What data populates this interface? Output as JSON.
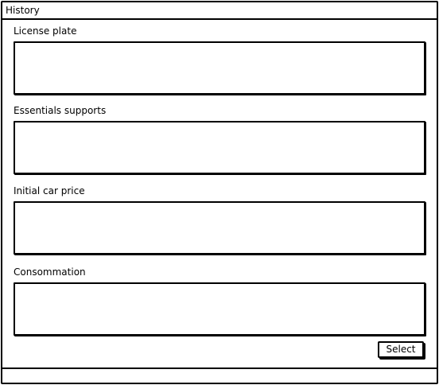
{
  "window": {
    "title": "History"
  },
  "fields": [
    {
      "label": "License plate",
      "value": ""
    },
    {
      "label": "Essentials supports",
      "value": ""
    },
    {
      "label": "Initial car price",
      "value": ""
    },
    {
      "label": "Consommation",
      "value": ""
    }
  ],
  "actions": {
    "select_label": "Select"
  },
  "statusbar": {
    "text": ""
  }
}
